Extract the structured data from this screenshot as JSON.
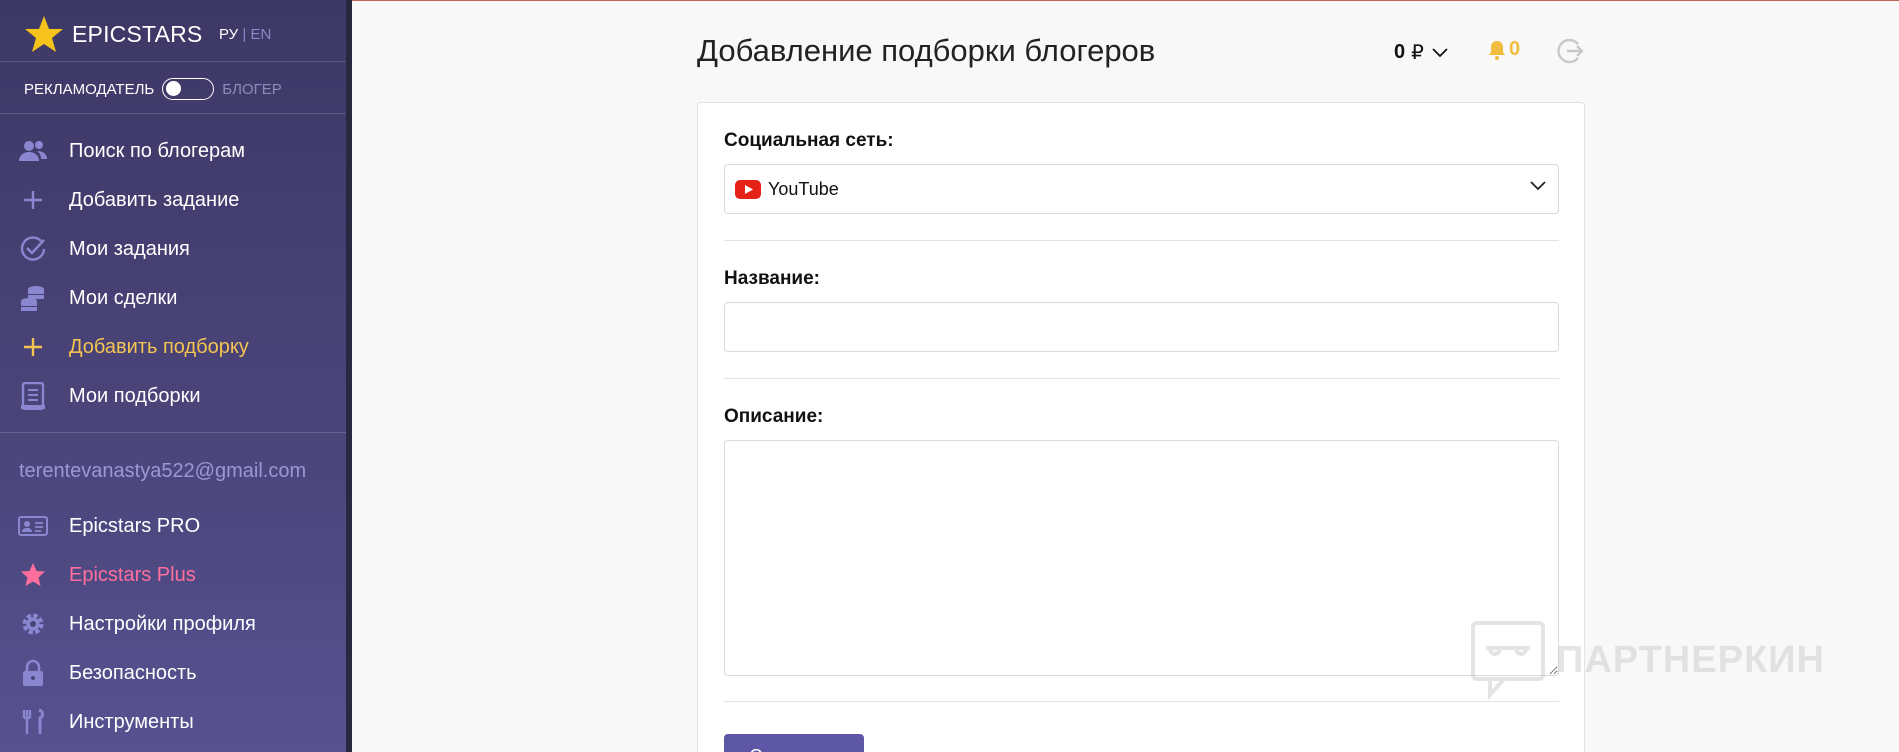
{
  "brand": {
    "name": "EPICSTARS"
  },
  "lang": {
    "ru": "РУ",
    "sep": "|",
    "en": "EN"
  },
  "role": {
    "advertiser": "РЕКЛАМОДАТЕЛЬ",
    "blogger": "БЛОГЕР"
  },
  "nav": {
    "items": [
      {
        "label": "Поиск по блогерам",
        "icon": "users-icon"
      },
      {
        "label": "Добавить задание",
        "icon": "plus-icon"
      },
      {
        "label": "Мои задания",
        "icon": "check-circle-icon"
      },
      {
        "label": "Мои сделки",
        "icon": "coins-icon"
      },
      {
        "label": "Добавить подборку",
        "icon": "plus-icon",
        "active": true
      },
      {
        "label": "Мои подборки",
        "icon": "list-document-icon"
      }
    ]
  },
  "account": {
    "email": "terentevanastya522@gmail.com",
    "items": [
      {
        "label": "Epicstars PRO",
        "icon": "id-card-icon"
      },
      {
        "label": "Epicstars Plus",
        "icon": "star-icon"
      },
      {
        "label": "Настройки профиля",
        "icon": "gear-icon"
      },
      {
        "label": "Безопасность",
        "icon": "lock-icon"
      },
      {
        "label": "Инструменты",
        "icon": "tools-icon"
      }
    ]
  },
  "header": {
    "title": "Добавление подборки блогеров",
    "balance": "0",
    "currency": "₽",
    "notifications": "0"
  },
  "form": {
    "network_label": "Социальная сеть:",
    "network_value": "YouTube",
    "name_label": "Название:",
    "name_value": "",
    "description_label": "Описание:",
    "description_value": "",
    "submit_label": "Сохранить"
  },
  "watermark": {
    "text": "ПАРТНЕРКИН"
  },
  "colors": {
    "sidebar_top": "#3e3866",
    "sidebar_bottom": "#575190",
    "accent_active": "#f5c452",
    "accent_plus": "#ff6e9c",
    "icon_purple": "#8b86d0",
    "bell": "#f1bd3f",
    "button": "#5e57a6"
  }
}
